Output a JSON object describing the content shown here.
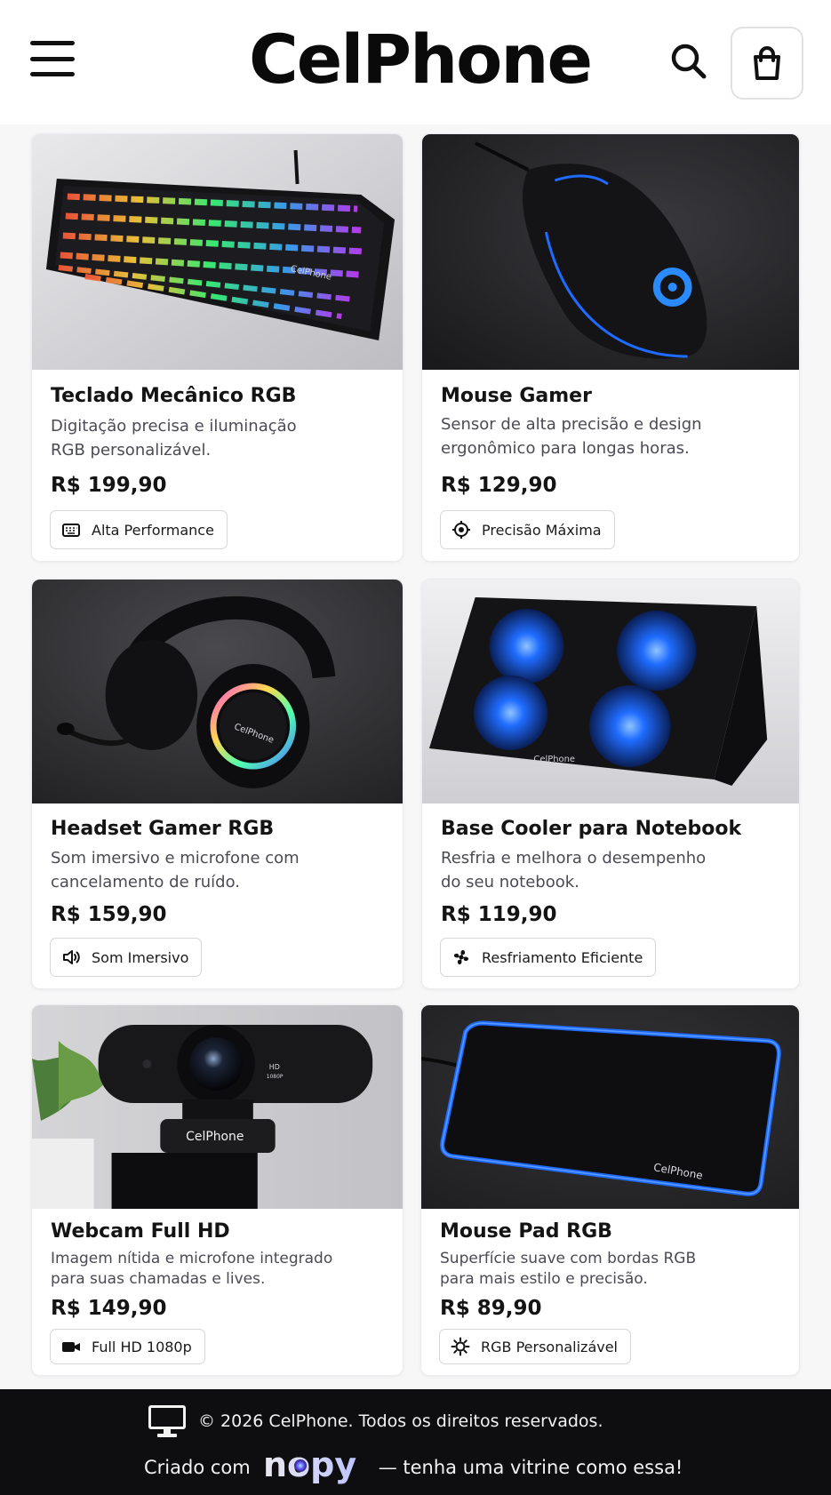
{
  "header": {
    "brand": "CelPhone",
    "menu_icon": "hamburger-menu-icon",
    "search_icon": "search-icon",
    "cart_icon": "shopping-bag-icon"
  },
  "products": [
    {
      "title": "Teclado Mecânico RGB",
      "desc_line1": "Digitação precisa e iluminação",
      "desc_line2": "RGB personalizável.",
      "price": "R$ 199,90",
      "badge": "Alta Performance",
      "badge_icon": "keyboard-icon",
      "image": "rgb-mechanical-keyboard-photo",
      "image_brand_text": "CelPhone"
    },
    {
      "title": "Mouse Gamer",
      "desc_line1": "Sensor de alta precisão e design",
      "desc_line2": "ergonômico para longas horas.",
      "price": "R$ 129,90",
      "badge": "Precisão Máxima",
      "badge_icon": "target-icon",
      "image": "gaming-mouse-photo"
    },
    {
      "title": "Headset Gamer RGB",
      "desc_line1": "Som imersivo e microfone com",
      "desc_line2": "cancelamento de ruído.",
      "price": "R$ 159,90",
      "badge": "Som Imersivo",
      "badge_icon": "speaker-icon",
      "image": "rgb-gaming-headset-photo",
      "image_brand_text": "CelPhone"
    },
    {
      "title": "Base Cooler para Notebook",
      "desc_line1": "Resfria e melhora o desempenho",
      "desc_line2": "do seu notebook.",
      "price": "R$ 119,90",
      "badge": "Resfriamento Eficiente",
      "badge_icon": "fan-icon",
      "image": "notebook-cooler-base-photo",
      "image_brand_text": "CelPhone"
    },
    {
      "title": "Webcam Full HD",
      "desc_line1": "Imagem nítida e microfone integrado",
      "desc_line2": "para suas chamadas e lives.",
      "price": "R$ 149,90",
      "badge": "Full HD 1080p",
      "badge_icon": "video-camera-icon",
      "image": "full-hd-webcam-photo",
      "image_brand_text": "CelPhone",
      "image_hd_text": "HD",
      "image_res_text": "1080P"
    },
    {
      "title": "Mouse Pad RGB",
      "desc_line1": "Superfície suave com bordas RGB",
      "desc_line2": "para mais estilo e precisão.",
      "price": "R$ 89,90",
      "badge": "RGB Personalizável",
      "badge_icon": "sun-icon",
      "image": "rgb-mouse-pad-photo",
      "image_brand_text": "CelPhone"
    }
  ],
  "footer": {
    "copyright": "© 2026 CelPhone. Todos os direitos reservados.",
    "created_prefix": "Criado com",
    "created_brand": "nopy",
    "created_suffix": "— tenha uma vitrine como essa!",
    "monitor_icon": "monitor-icon"
  },
  "colors": {
    "accent_blue": "#1e6bff",
    "text_dark": "#141414",
    "text_muted": "#4a4a55",
    "footer_bg": "#0e0e11"
  }
}
